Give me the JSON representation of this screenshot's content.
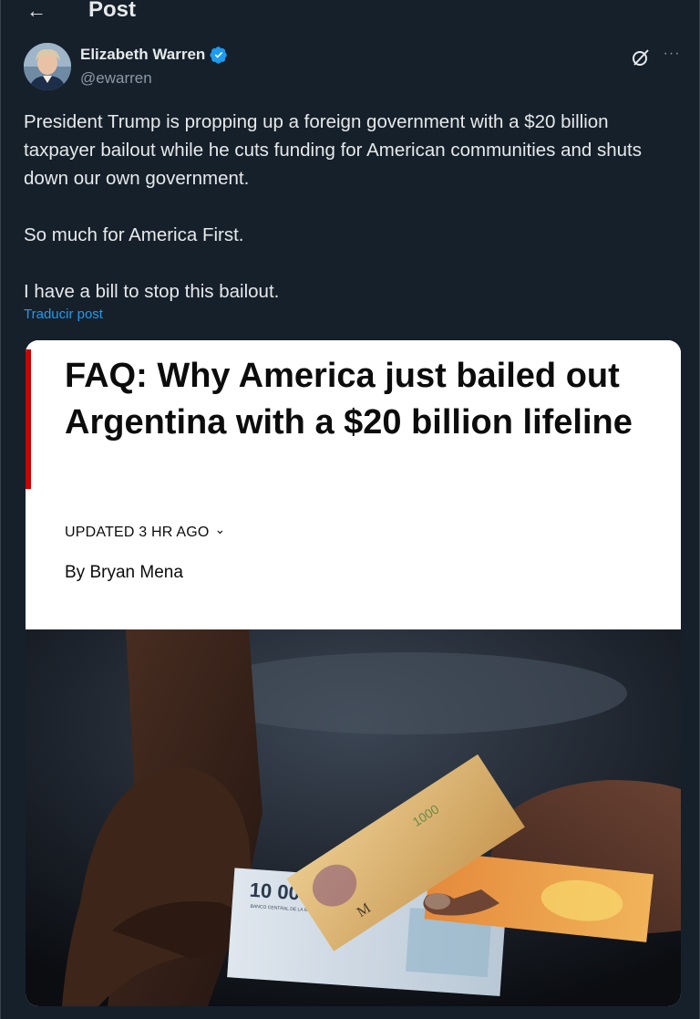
{
  "header": {
    "title": "Post",
    "back_icon": "arrow-left-icon"
  },
  "author": {
    "name": "Elizabeth Warren",
    "handle": "@ewarren",
    "verified": true,
    "verified_color": "#1d9bf0"
  },
  "post": {
    "paragraphs": [
      "President Trump is propping up a foreign government with a $20 billion taxpayer bailout while he cuts funding for American communities and shuts down our own government.",
      "So much for America First.",
      "I have a bill to stop this bailout."
    ],
    "translate_label": "Traducir post"
  },
  "article": {
    "headline": "FAQ: Why America just bailed out Argentina with a $20 billion lifeline",
    "updated": "UPDATED 3 HR AGO",
    "byline": "By Bryan Mena",
    "accent_color": "#cc0000",
    "photo": {
      "banknote_main": "10 000",
      "banknote_fine": "BANCO CENTRAL DE LA REPÚBLICA ARGENTINA",
      "banknote_second": "1000",
      "banknote_letter": "M"
    }
  },
  "colors": {
    "background": "#15202b",
    "text": "#e7e9ea",
    "secondary_text": "#8b98a5",
    "link": "#1d9bf0"
  }
}
